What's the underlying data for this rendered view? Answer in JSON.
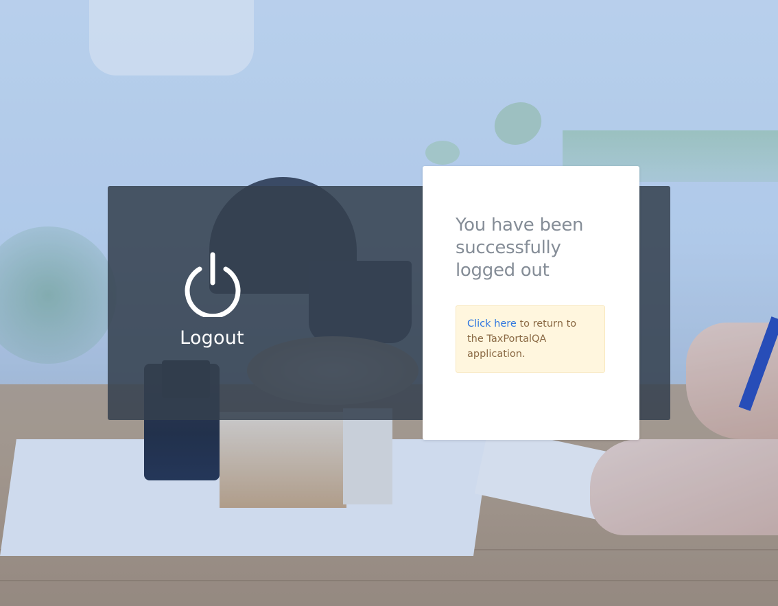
{
  "logout_panel": {
    "icon": "power-icon",
    "label": "Logout"
  },
  "card": {
    "title": "You have been successfully logged out",
    "notice": {
      "link_text": "Click here",
      "text": " to return to the TaxPortalQA application."
    }
  },
  "colors": {
    "panel_background": "#34404e",
    "card_background": "#ffffff",
    "title_color": "#858d97",
    "notice_background": "#fff6de",
    "notice_text": "#8b6a45",
    "link_color": "#2f76e0"
  }
}
